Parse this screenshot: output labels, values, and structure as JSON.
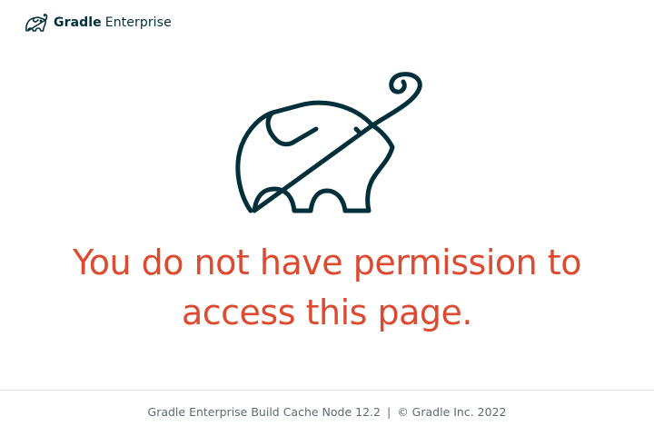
{
  "header": {
    "brand_bold": "Gradle",
    "brand_light": "Enterprise",
    "logo_icon": "elephant-logo-icon"
  },
  "main": {
    "illustration": "elephant-icon",
    "message_line1": "You do not have permission to",
    "message_line2": "access this page."
  },
  "footer": {
    "product": "Gradle Enterprise Build Cache Node 12.2",
    "separator": "|",
    "copyright": "© Gradle Inc. 2022"
  },
  "colors": {
    "brand_dark": "#02303a",
    "error_red": "#dd4a30",
    "footer_text": "#5c6b72"
  }
}
